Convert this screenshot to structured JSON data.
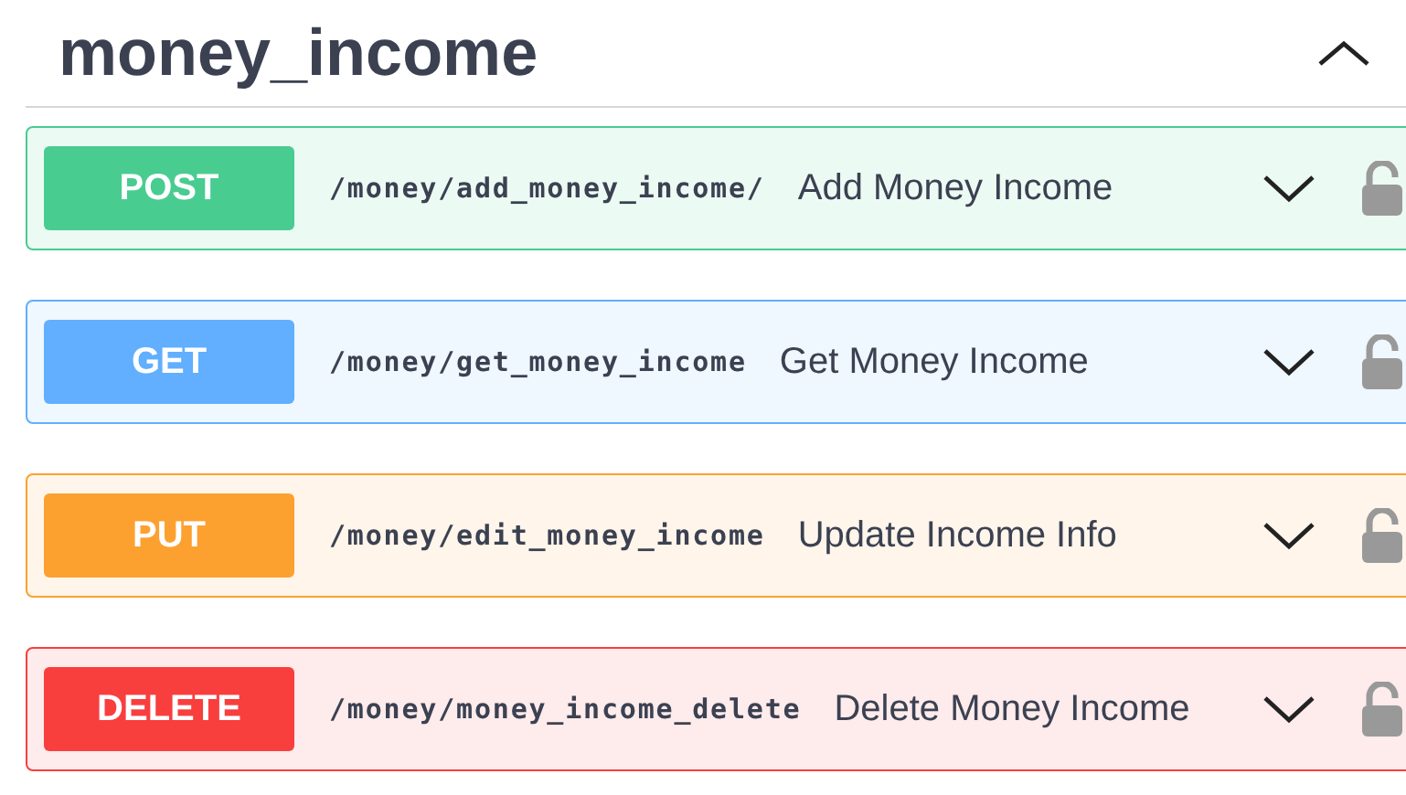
{
  "section": {
    "title": "money_income",
    "expanded": true
  },
  "operations": [
    {
      "method": "POST",
      "color": "#49cc90",
      "path": "/money/add_money_income/",
      "summary": "Add Money Income",
      "expanded": false
    },
    {
      "method": "GET",
      "color": "#61affe",
      "path": "/money/get_money_income",
      "summary": "Get Money Income",
      "expanded": false
    },
    {
      "method": "PUT",
      "color": "#fca130",
      "path": "/money/edit_money_income",
      "summary": "Update Income Info",
      "expanded": false
    },
    {
      "method": "DELETE",
      "color": "#f93e3e",
      "path": "/money/money_income_delete",
      "summary": "Delete Money Income",
      "expanded": false
    }
  ]
}
